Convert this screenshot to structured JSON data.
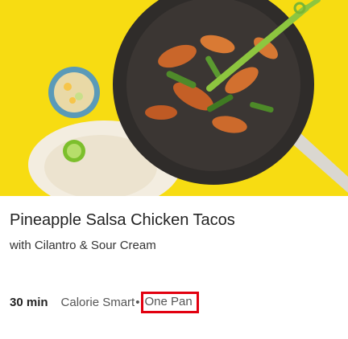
{
  "recipe": {
    "title": "Pineapple Salsa Chicken Tacos",
    "subtitle": "with Cilantro & Sour Cream",
    "time": "30 min",
    "tags": [
      "Calorie Smart",
      "One Pan"
    ],
    "separator": "•"
  },
  "image": {
    "icon": "food-photo",
    "colors": {
      "background": "#f5d90a",
      "pan": "#2f2c2a",
      "accent": "#8dc63f"
    }
  },
  "highlight_color": "#e2000f"
}
